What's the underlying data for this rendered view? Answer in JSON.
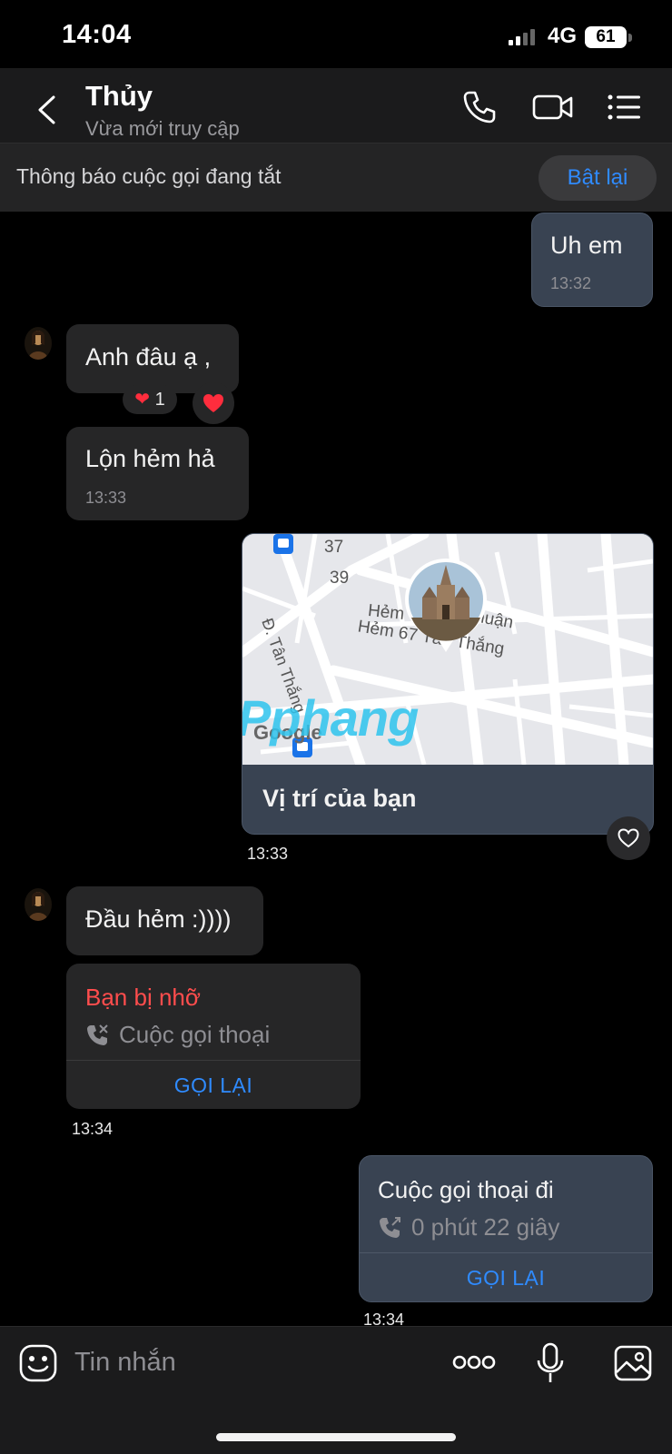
{
  "status_bar": {
    "time": "14:04",
    "network": "4G",
    "battery": "61"
  },
  "header": {
    "contact_name": "Thủy",
    "contact_status": "Vừa mới truy cập"
  },
  "notice": {
    "text": "Thông báo cuộc gọi đang tắt",
    "button": "Bật lại"
  },
  "messages": {
    "m1": {
      "text": "Uh em",
      "time": "13:32"
    },
    "m2": {
      "text": "Anh đâu ạ ,",
      "reaction_count": "1"
    },
    "m3": {
      "text": "Lộn hẻm hả",
      "time": "13:33"
    },
    "m4": {
      "caption": "Vị trí của bạn",
      "time": "13:33",
      "map_labels": {
        "n1": "37",
        "n2": "39",
        "street": "Đ. Tân Thắng",
        "alley1": "Hẻm",
        "alley1b": "huận",
        "alley2": "Hẻm 67 Tân Thắng",
        "google": "Google",
        "watermark": "Pphang"
      }
    },
    "m5": {
      "text": "Đầu hẻm :))))"
    },
    "m6": {
      "title": "Bạn bị nhỡ",
      "subtitle": "Cuộc gọi thoại",
      "action": "GỌI LẠI",
      "time": "13:34"
    },
    "m7": {
      "title": "Cuộc gọi thoại đi",
      "subtitle": "0 phút 22 giây",
      "action": "GỌI LẠI",
      "time": "13:34"
    }
  },
  "composer": {
    "placeholder": "Tin nhắn"
  },
  "colors": {
    "accent": "#2f8bff",
    "missed": "#ff4d4d",
    "outgoing_bubble": "#394352",
    "incoming_bubble": "#262627"
  },
  "icons": [
    "back-chevron-icon",
    "phone-icon",
    "video-call-icon",
    "menu-list-icon",
    "heart-icon",
    "phone-call-icon",
    "sticker-icon",
    "more-dots-icon",
    "microphone-icon",
    "image-icon",
    "bus-stop-icon",
    "church-pin-icon"
  ]
}
